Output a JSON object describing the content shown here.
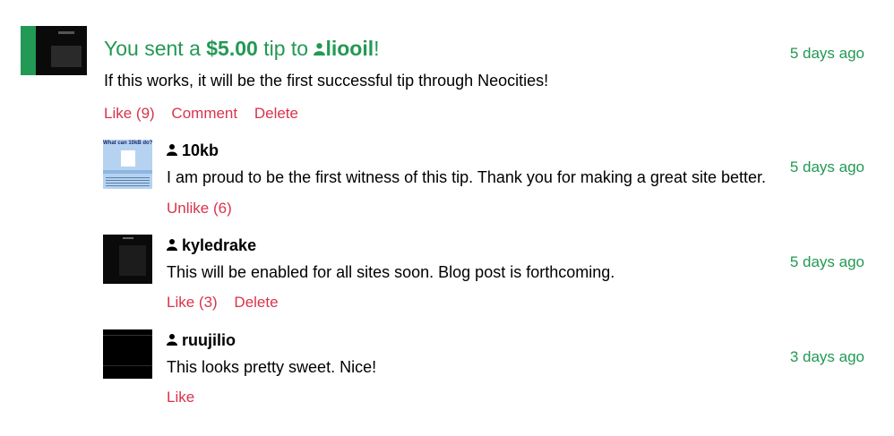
{
  "event": {
    "headline_prefix": "You sent a",
    "amount": "$5.00",
    "headline_mid": "tip to",
    "recipient": "liooil",
    "headline_suffix": "!",
    "message": "If this works, it will be the first successful tip through Neocities!",
    "timestamp": "5 days ago",
    "actions": {
      "like": "Like (9)",
      "comment": "Comment",
      "delete": "Delete"
    }
  },
  "comments": [
    {
      "username": "10kb",
      "text": "I am proud to be the first witness of this tip. Thank you for making a great site better.",
      "timestamp": "5 days ago",
      "like_label": "Unlike (6)",
      "thumb_text": "What can 10kB do?"
    },
    {
      "username": "kyledrake",
      "text": "This will be enabled for all sites soon. Blog post is forthcoming.",
      "timestamp": "5 days ago",
      "like_label": "Like (3)",
      "delete_label": "Delete"
    },
    {
      "username": "ruujilio",
      "text": "This looks pretty sweet. Nice!",
      "timestamp": "3 days ago",
      "like_label": "Like"
    }
  ],
  "colors": {
    "green": "#229954",
    "red": "#d9334c"
  },
  "icons": {
    "user": "person-icon"
  }
}
